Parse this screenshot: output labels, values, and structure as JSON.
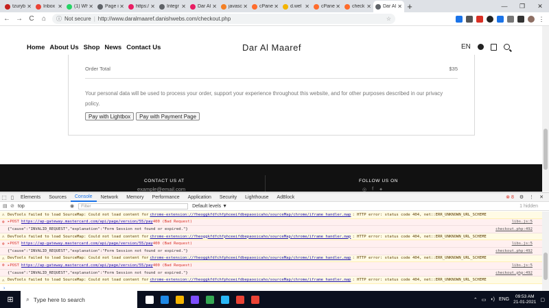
{
  "browser": {
    "tabs": [
      {
        "label": "tzuryb",
        "color": "#c5221f"
      },
      {
        "label": "Inbox",
        "color": "#ea4335"
      },
      {
        "label": "(1) Wh",
        "color": "#25d366"
      },
      {
        "label": "Page i",
        "color": "#5f6368"
      },
      {
        "label": "https:/",
        "color": "#e91e63"
      },
      {
        "label": "Integr",
        "color": "#5f6368"
      },
      {
        "label": "Dar Al",
        "color": "#e91e63"
      },
      {
        "label": "javasc",
        "color": "#f48024"
      },
      {
        "label": "cPanel",
        "color": "#ff6c2c"
      },
      {
        "label": "d.wel",
        "color": "#f4b400"
      },
      {
        "label": "cPanel",
        "color": "#ff6c2c"
      },
      {
        "label": "check",
        "color": "#ff6c2c"
      },
      {
        "label": "Dar Al",
        "color": "#5f6368",
        "active": true
      }
    ],
    "new_tab": "+",
    "back": "←",
    "forward": "→",
    "reload": "C",
    "home": "⌂",
    "security_label": "Not secure",
    "url": "http://www.daralmaaref.danishwebs.com/checkout.php",
    "min": "—",
    "max": "❐",
    "close": "✕"
  },
  "site": {
    "nav": [
      "Home",
      "About Us",
      "Shop",
      "News",
      "Contact Us"
    ],
    "brand": "Dar Al Maaref",
    "language": "EN"
  },
  "checkout": {
    "order_total_label": "Order Total",
    "order_total_value": "$35",
    "privacy_text": "Your personal data will be used to process your order, support your experience throughout this website, and for other purposes described in our privacy policy.",
    "pay_lightbox": "Pay with Lightbox",
    "pay_page": "Pay with Payment Page"
  },
  "footer": {
    "contact_heading": "CONTACT US AT",
    "email": "example@email.com",
    "follow_heading": "FOLLOW US ON",
    "social": [
      "◎",
      "f",
      "✦"
    ]
  },
  "devtools": {
    "tabs": [
      "Elements",
      "Sources",
      "Console",
      "Network",
      "Memory",
      "Performance",
      "Application",
      "Security",
      "Lighthouse",
      "AdBlock"
    ],
    "active_tab": "Console",
    "error_count": "8",
    "context": "top",
    "filter_placeholder": "Filter",
    "levels": "Default levels ▼",
    "hidden": "1 hidden",
    "messages": [
      {
        "level": "warn",
        "text": "DevTools failed to load SourceMap: Could not load content for ",
        "link": "chrome-extension://fheoggkfdfchfphceeifdbepaooicaho/sourceMap/chrome/iframe_handler.map",
        "tail": ": HTTP error: status code 404, net::ERR_UNKNOWN_URL_SCHEME",
        "src": ""
      },
      {
        "level": "error",
        "text": "▸POST ",
        "link": "https://ap-gateway.mastercard.com/api/page/version/55/pay",
        "tail": " 400 (Bad Request)",
        "src": "libs.js:5"
      },
      {
        "level": "info",
        "text": "{\"cause\":\"INVALID_REQUEST\",\"explanation\":\"Form Session not found or expired.\"}",
        "link": "",
        "tail": "",
        "src": "checkout.php:492"
      },
      {
        "level": "warn",
        "text": "DevTools failed to load SourceMap: Could not load content for ",
        "link": "chrome-extension://fheoggkfdfchfphceeifdbepaooicaho/sourceMap/chrome/iframe_handler.map",
        "tail": ": HTTP error: status code 404, net::ERR_UNKNOWN_URL_SCHEME",
        "src": ""
      },
      {
        "level": "error",
        "text": "▸POST ",
        "link": "https://ap-gateway.mastercard.com/api/page/version/55/pay",
        "tail": " 400 (Bad Request)",
        "src": "libs.js:5"
      },
      {
        "level": "info",
        "text": "{\"cause\":\"INVALID_REQUEST\",\"explanation\":\"Form Session not found or expired.\"}",
        "link": "",
        "tail": "",
        "src": "checkout.php:492"
      },
      {
        "level": "warn",
        "text": "DevTools failed to load SourceMap: Could not load content for ",
        "link": "chrome-extension://fheoggkfdfchfphceeifdbepaooicaho/sourceMap/chrome/iframe_handler.map",
        "tail": ": HTTP error: status code 404, net::ERR_UNKNOWN_URL_SCHEME",
        "src": ""
      },
      {
        "level": "error",
        "text": "▸POST ",
        "link": "https://ap-gateway.mastercard.com/api/page/version/55/pay",
        "tail": " 400 (Bad Request)",
        "src": "libs.js:5"
      },
      {
        "level": "info",
        "text": "{\"cause\":\"INVALID_REQUEST\",\"explanation\":\"Form Session not found or expired.\"}",
        "link": "",
        "tail": "",
        "src": "checkout.php:492"
      },
      {
        "level": "warn",
        "text": "DevTools failed to load SourceMap: Could not load content for ",
        "link": "chrome-extension://fheoggkfdfchfphceeifdbepaooicaho/sourceMap/chrome/iframe_handler.map",
        "tail": ": HTTP error: status code 404, net::ERR_UNKNOWN_URL_SCHEME",
        "src": ""
      }
    ],
    "prompt": "›"
  },
  "taskbar": {
    "search_placeholder": "Type here to search",
    "apps": [
      "#ffffff",
      "#1e88e5",
      "#f4b400",
      "#7c4dff",
      "#34a853",
      "#29b6f6",
      "#ea4335",
      "#ea4335"
    ],
    "language": "ENG",
    "time": "09:53 AM",
    "date": "21-01-2021"
  }
}
